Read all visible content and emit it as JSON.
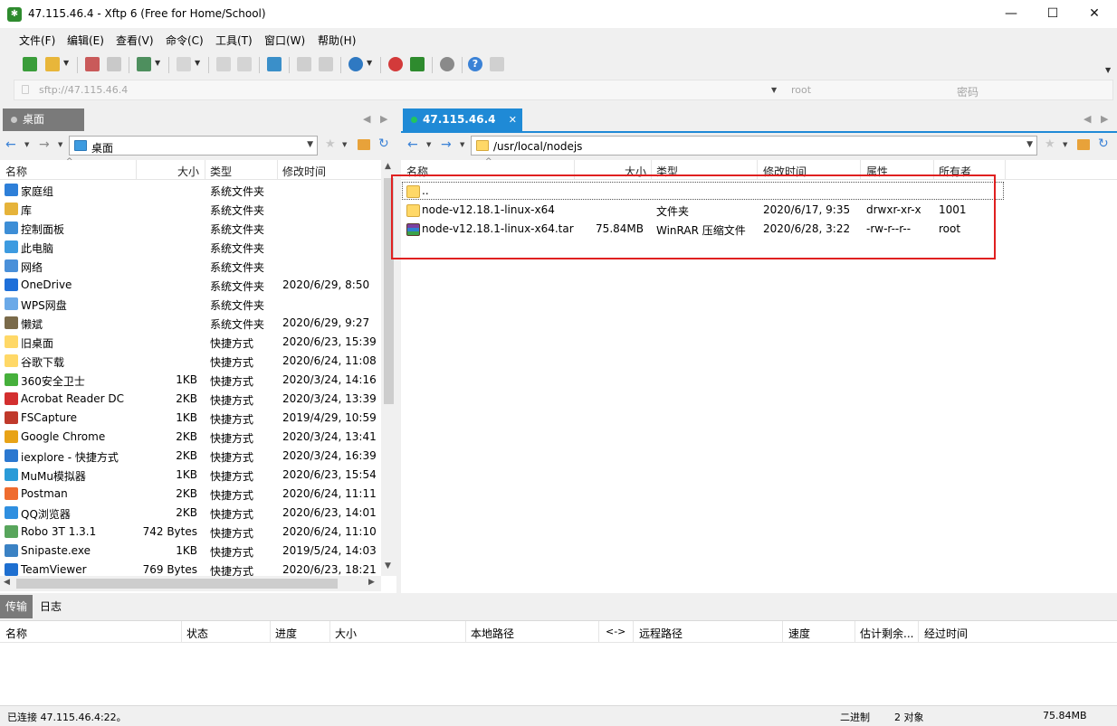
{
  "window": {
    "title": "47.115.46.4 - Xftp 6 (Free for Home/School)",
    "app_icon": "xftp-icon"
  },
  "menu": [
    "文件(F)",
    "编辑(E)",
    "查看(V)",
    "命令(C)",
    "工具(T)",
    "窗口(W)",
    "帮助(H)"
  ],
  "address": {
    "host": "sftp://47.115.46.4",
    "user": "root",
    "password_placeholder": "密码"
  },
  "left_pane": {
    "tab": "桌面",
    "path": "桌面",
    "columns": [
      "名称",
      "大小",
      "类型",
      "修改时间"
    ],
    "files": [
      {
        "name": "家庭组",
        "size": "",
        "type": "系统文件夹",
        "modified": "",
        "icon": "homegroup-icon",
        "color": "#2e7fd8"
      },
      {
        "name": "库",
        "size": "",
        "type": "系统文件夹",
        "modified": "",
        "icon": "library-icon",
        "color": "#e6b33a"
      },
      {
        "name": "控制面板",
        "size": "",
        "type": "系统文件夹",
        "modified": "",
        "icon": "control-panel-icon",
        "color": "#3d8ed6"
      },
      {
        "name": "此电脑",
        "size": "",
        "type": "系统文件夹",
        "modified": "",
        "icon": "computer-icon",
        "color": "#3d9be0"
      },
      {
        "name": "网络",
        "size": "",
        "type": "系统文件夹",
        "modified": "",
        "icon": "network-icon",
        "color": "#4a90d9"
      },
      {
        "name": "OneDrive",
        "size": "",
        "type": "系统文件夹",
        "modified": "2020/6/29, 8:50",
        "icon": "onedrive-icon",
        "color": "#1e6fd9"
      },
      {
        "name": "WPS网盘",
        "size": "",
        "type": "系统文件夹",
        "modified": "",
        "icon": "cloud-icon",
        "color": "#6aa9e8"
      },
      {
        "name": "懒斌",
        "size": "",
        "type": "系统文件夹",
        "modified": "2020/6/29, 9:27",
        "icon": "user-icon",
        "color": "#7a6a4a"
      },
      {
        "name": "旧桌面",
        "size": "",
        "type": "快捷方式",
        "modified": "2020/6/23, 15:39",
        "icon": "folder-icon",
        "color": "#ffd867"
      },
      {
        "name": "谷歌下载",
        "size": "",
        "type": "快捷方式",
        "modified": "2020/6/24, 11:08",
        "icon": "folder-icon",
        "color": "#ffd867"
      },
      {
        "name": "360安全卫士",
        "size": "1KB",
        "type": "快捷方式",
        "modified": "2020/3/24, 14:16",
        "icon": "shield-icon",
        "color": "#46b03c"
      },
      {
        "name": "Acrobat Reader DC",
        "size": "2KB",
        "type": "快捷方式",
        "modified": "2020/3/24, 13:39",
        "icon": "pdf-icon",
        "color": "#d32f2f"
      },
      {
        "name": "FSCapture",
        "size": "1KB",
        "type": "快捷方式",
        "modified": "2019/4/29, 10:59",
        "icon": "capture-icon",
        "color": "#c0392b"
      },
      {
        "name": "Google Chrome",
        "size": "2KB",
        "type": "快捷方式",
        "modified": "2020/3/24, 13:41",
        "icon": "chrome-icon",
        "color": "#e8a317"
      },
      {
        "name": "iexplore - 快捷方式",
        "size": "2KB",
        "type": "快捷方式",
        "modified": "2020/3/24, 16:39",
        "icon": "ie-icon",
        "color": "#2b78d0"
      },
      {
        "name": "MuMu模拟器",
        "size": "1KB",
        "type": "快捷方式",
        "modified": "2020/6/23, 15:54",
        "icon": "emulator-icon",
        "color": "#2a9bd8"
      },
      {
        "name": "Postman",
        "size": "2KB",
        "type": "快捷方式",
        "modified": "2020/6/24, 11:11",
        "icon": "postman-icon",
        "color": "#ef6c2f"
      },
      {
        "name": "QQ浏览器",
        "size": "2KB",
        "type": "快捷方式",
        "modified": "2020/6/23, 14:01",
        "icon": "browser-icon",
        "color": "#2f8fe0"
      },
      {
        "name": "Robo 3T 1.3.1",
        "size": "742 Bytes",
        "type": "快捷方式",
        "modified": "2020/6/24, 11:10",
        "icon": "robo-icon",
        "color": "#58a55c"
      },
      {
        "name": "Snipaste.exe",
        "size": "1KB",
        "type": "快捷方式",
        "modified": "2019/5/24, 14:03",
        "icon": "snipaste-icon",
        "color": "#3b82c4"
      },
      {
        "name": "TeamViewer",
        "size": "769 Bytes",
        "type": "快捷方式",
        "modified": "2020/6/23, 18:21",
        "icon": "teamviewer-icon",
        "color": "#1e6fd0"
      }
    ]
  },
  "right_pane": {
    "tab": "47.115.46.4",
    "tab_status_color": "#22c55e",
    "path": "/usr/local/nodejs",
    "columns": [
      "名称",
      "大小",
      "类型",
      "修改时间",
      "属性",
      "所有者"
    ],
    "files": [
      {
        "name": "..",
        "size": "",
        "type": "",
        "modified": "",
        "attr": "",
        "owner": "",
        "icon": "folder-icon"
      },
      {
        "name": "node-v12.18.1-linux-x64",
        "size": "",
        "type": "文件夹",
        "modified": "2020/6/17, 9:35",
        "attr": "drwxr-xr-x",
        "owner": "1001",
        "icon": "folder-icon"
      },
      {
        "name": "node-v12.18.1-linux-x64.tar",
        "size": "75.84MB",
        "type": "WinRAR 压缩文件",
        "modified": "2020/6/28, 3:22",
        "attr": "-rw-r--r--",
        "owner": "root",
        "icon": "winrar-icon"
      }
    ],
    "highlight_color": "#e02020"
  },
  "transfer": {
    "tabs": [
      "传输",
      "日志"
    ],
    "columns": [
      "名称",
      "状态",
      "进度",
      "大小",
      "本地路径",
      "<->",
      "远程路径",
      "速度",
      "估计剩余...",
      "经过时间"
    ]
  },
  "status": {
    "connection": "已连接 47.115.46.4:22。",
    "mode": "二进制",
    "count": "2 对象",
    "size": "75.84MB"
  }
}
